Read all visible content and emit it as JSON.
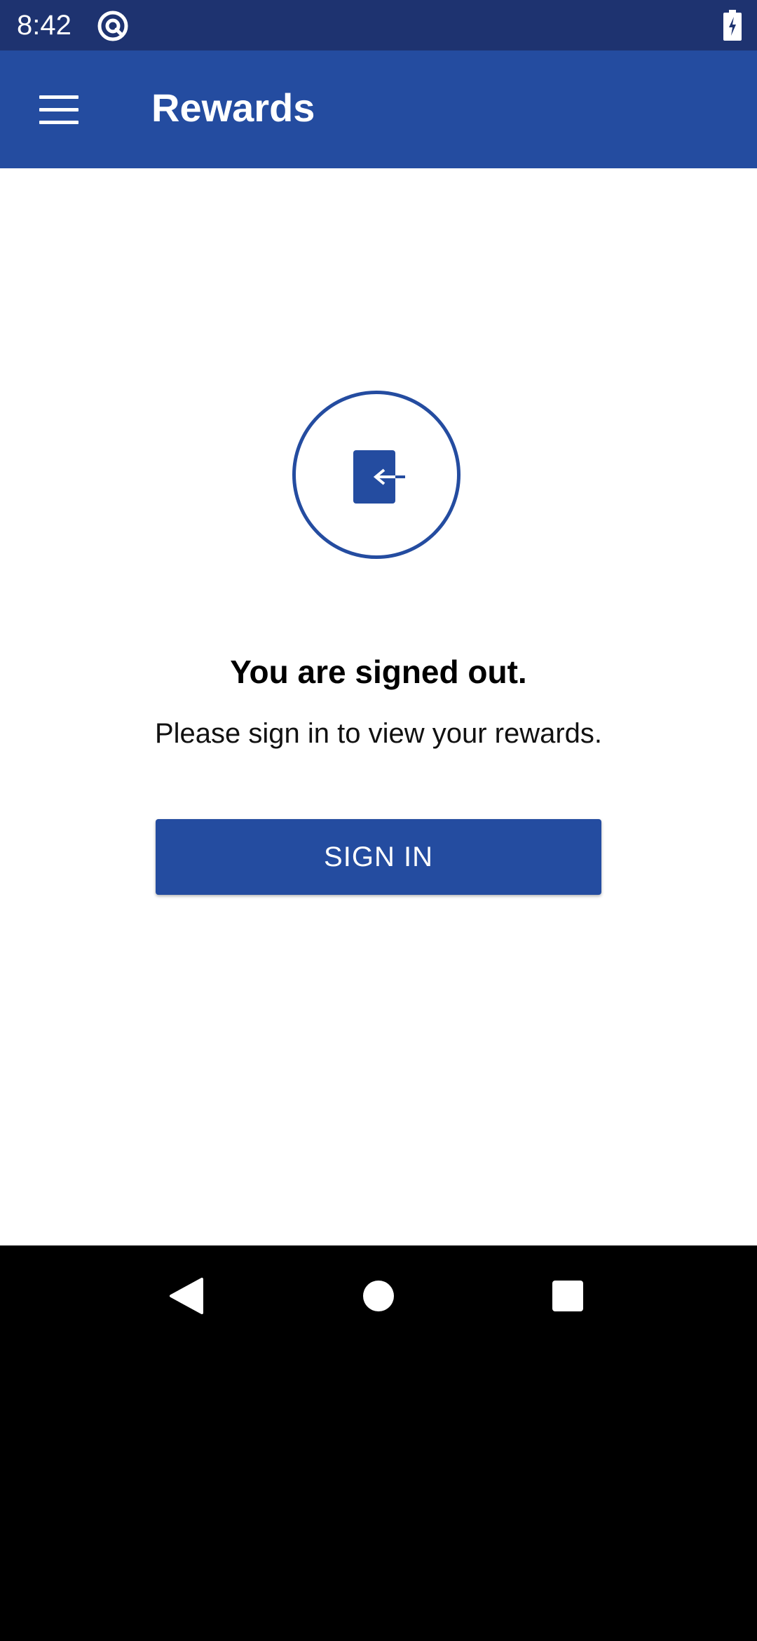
{
  "status_bar": {
    "time": "8:42",
    "app_icon": "at-sign-icon",
    "battery_icon": "battery-charging-icon",
    "background_color": "#1E3370"
  },
  "app_bar": {
    "title": "Rewards",
    "menu_icon": "hamburger-menu-icon",
    "background_color": "#244CA0"
  },
  "content": {
    "status_icon": "sign-in-door-arrow-icon",
    "heading": "You are signed out.",
    "message": "Please sign in to view your rewards.",
    "sign_in_label": "SIGN IN",
    "accent_color": "#244CA0"
  },
  "nav_bar": {
    "back_icon": "back-triangle-icon",
    "home_icon": "home-circle-icon",
    "recents_icon": "recents-square-icon"
  }
}
